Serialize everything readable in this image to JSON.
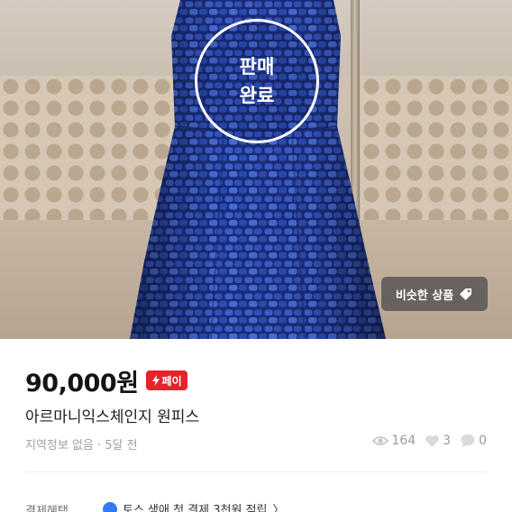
{
  "photo": {
    "sold_line1": "판매",
    "sold_line2": "완료",
    "similar_button_label": "비슷한 상품",
    "dress_color": "#1f3c9c"
  },
  "product": {
    "price": "90,000원",
    "pay_badge_label": "페이",
    "title": "아르마니익스체인지 원피스",
    "location_time": "지역정보 없음 · 5달 전",
    "views": "164",
    "likes": "3",
    "chats": "0"
  },
  "benefit": {
    "label": "결제혜택",
    "text": "토스 생애 첫 결제 3천원 적립",
    "chevron": "〉"
  },
  "colors": {
    "accent_red": "#e5232b",
    "toss_blue": "#2f7cf6"
  }
}
